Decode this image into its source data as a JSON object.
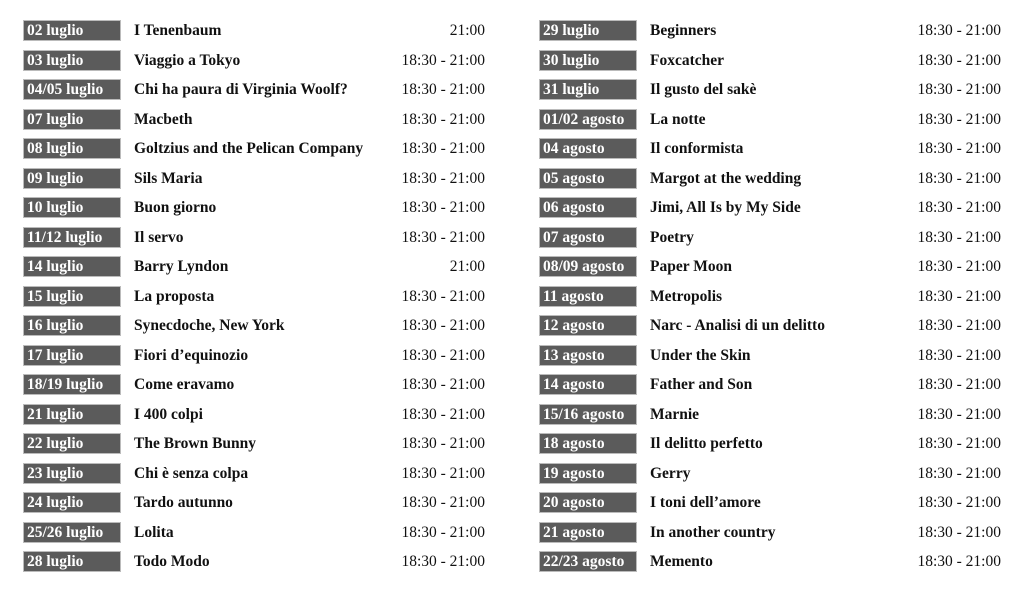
{
  "columns": [
    [
      {
        "date": "02 luglio",
        "title": "I Tenenbaum",
        "time": "21:00"
      },
      {
        "date": "03 luglio",
        "title": "Viaggio a Tokyo",
        "time": "18:30 - 21:00"
      },
      {
        "date": "04/05 luglio",
        "title": "Chi ha paura di Virginia Woolf?",
        "time": "18:30 - 21:00"
      },
      {
        "date": "07 luglio",
        "title": "Macbeth",
        "time": "18:30 - 21:00"
      },
      {
        "date": "08 luglio",
        "title": "Goltzius and the Pelican Company",
        "time": "18:30 - 21:00"
      },
      {
        "date": "09 luglio",
        "title": "Sils Maria",
        "time": "18:30 - 21:00"
      },
      {
        "date": "10 luglio",
        "title": "Buon giorno",
        "time": "18:30 - 21:00"
      },
      {
        "date": "11/12 luglio",
        "title": "Il servo",
        "time": "18:30 - 21:00"
      },
      {
        "date": "14 luglio",
        "title": "Barry Lyndon",
        "time": "21:00"
      },
      {
        "date": "15 luglio",
        "title": "La proposta",
        "time": "18:30 - 21:00"
      },
      {
        "date": "16 luglio",
        "title": "Synecdoche, New York",
        "time": "18:30 - 21:00"
      },
      {
        "date": "17 luglio",
        "title": "Fiori d’equinozio",
        "time": "18:30 - 21:00"
      },
      {
        "date": "18/19 luglio",
        "title": "Come eravamo",
        "time": "18:30 - 21:00"
      },
      {
        "date": "21 luglio",
        "title": "I 400 colpi",
        "time": "18:30 - 21:00"
      },
      {
        "date": "22 luglio",
        "title": "The Brown Bunny",
        "time": "18:30 - 21:00"
      },
      {
        "date": "23 luglio",
        "title": "Chi è senza colpa",
        "time": "18:30 - 21:00"
      },
      {
        "date": "24 luglio",
        "title": "Tardo autunno",
        "time": "18:30 - 21:00"
      },
      {
        "date": "25/26 luglio",
        "title": "Lolita",
        "time": "18:30 - 21:00"
      },
      {
        "date": "28 luglio",
        "title": "Todo Modo",
        "time": "18:30 - 21:00"
      }
    ],
    [
      {
        "date": "29 luglio",
        "title": "Beginners",
        "time": "18:30 - 21:00"
      },
      {
        "date": "30 luglio",
        "title": "Foxcatcher",
        "time": "18:30 - 21:00"
      },
      {
        "date": "31 luglio",
        "title": "Il gusto del sakè",
        "time": "18:30 - 21:00"
      },
      {
        "date": "01/02 agosto",
        "title": "La notte",
        "time": "18:30 - 21:00"
      },
      {
        "date": "04 agosto",
        "title": "Il conformista",
        "time": "18:30 - 21:00"
      },
      {
        "date": "05 agosto",
        "title": "Margot at the wedding",
        "time": "18:30 - 21:00"
      },
      {
        "date": "06 agosto",
        "title": "Jimi, All Is by My Side",
        "time": "18:30 - 21:00"
      },
      {
        "date": "07 agosto",
        "title": "Poetry",
        "time": "18:30 - 21:00"
      },
      {
        "date": "08/09 agosto",
        "title": "Paper Moon",
        "time": "18:30 - 21:00"
      },
      {
        "date": "11 agosto",
        "title": "Metropolis",
        "time": "18:30 - 21:00"
      },
      {
        "date": "12 agosto",
        "title": "Narc - Analisi di un delitto",
        "time": "18:30 - 21:00"
      },
      {
        "date": "13 agosto",
        "title": "Under the Skin",
        "time": "18:30 - 21:00"
      },
      {
        "date": "14 agosto",
        "title": "Father and Son",
        "time": "18:30 - 21:00"
      },
      {
        "date": "15/16 agosto",
        "title": "Marnie",
        "time": "18:30 - 21:00"
      },
      {
        "date": "18 agosto",
        "title": "Il delitto perfetto",
        "time": "18:30 - 21:00"
      },
      {
        "date": "19 agosto",
        "title": "Gerry",
        "time": "18:30 - 21:00"
      },
      {
        "date": "20 agosto",
        "title": "I toni dell’amore",
        "time": "18:30 - 21:00"
      },
      {
        "date": "21 agosto",
        "title": "In another country",
        "time": "18:30 - 21:00"
      },
      {
        "date": "22/23 agosto",
        "title": "Memento",
        "time": "18:30 - 21:00"
      }
    ]
  ]
}
